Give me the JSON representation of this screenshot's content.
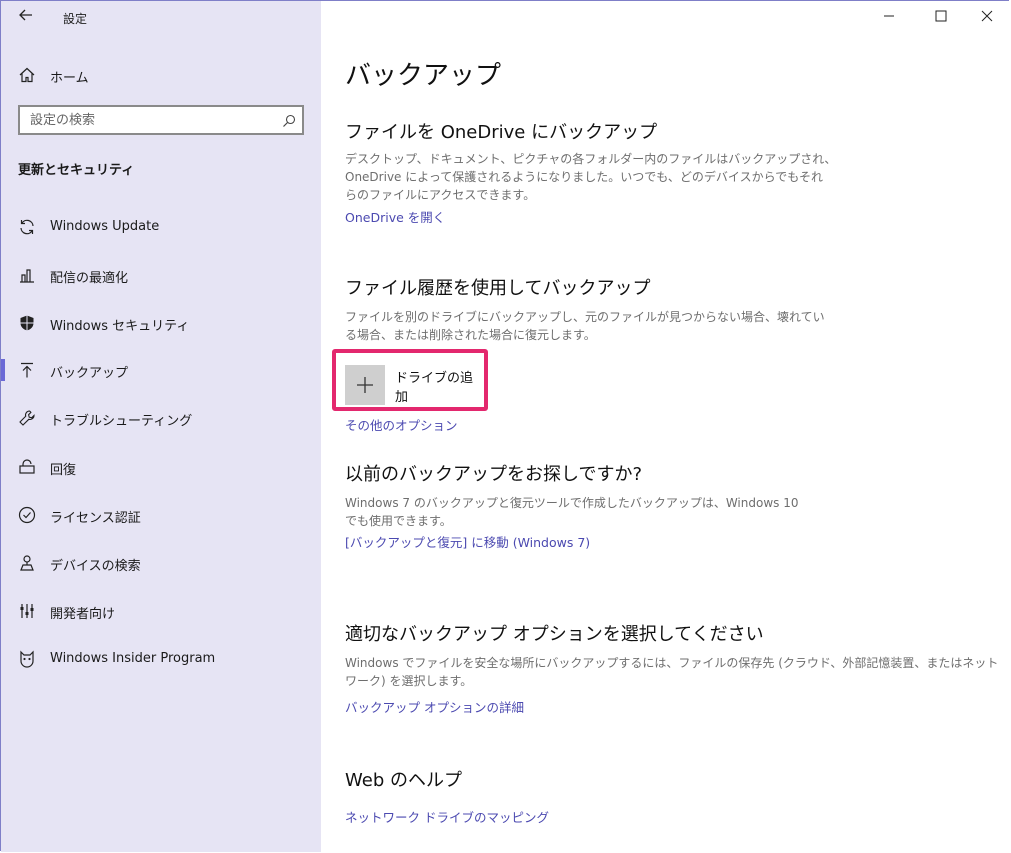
{
  "app": {
    "title": "設定"
  },
  "sidebar": {
    "home_label": "ホーム",
    "search_placeholder": "設定の検索",
    "section_title": "更新とセキュリティ",
    "items": [
      {
        "label": "Windows Update",
        "icon": "sync-icon"
      },
      {
        "label": "配信の最適化",
        "icon": "delivery-optimization-icon"
      },
      {
        "label": "Windows セキュリティ",
        "icon": "shield-icon"
      },
      {
        "label": "バックアップ",
        "icon": "backup-arrow-icon"
      },
      {
        "label": "トラブルシューティング",
        "icon": "wrench-icon"
      },
      {
        "label": "回復",
        "icon": "recovery-icon"
      },
      {
        "label": "ライセンス認証",
        "icon": "check-circle-icon"
      },
      {
        "label": "デバイスの検索",
        "icon": "find-device-icon"
      },
      {
        "label": "開発者向け",
        "icon": "developer-icon"
      },
      {
        "label": "Windows Insider Program",
        "icon": "insider-cat-icon"
      }
    ],
    "active_index": 3
  },
  "main": {
    "title": "バックアップ",
    "onedrive": {
      "heading": "ファイルを OneDrive にバックアップ",
      "line1": "デスクトップ、ドキュメント、ピクチャの各フォルダー内のファイルはバックアップされ、",
      "line2": "OneDrive によって保護されるようになりました。いつでも、どのデバイスからでもそれ",
      "line3": "らのファイルにアクセスできます。",
      "link": "OneDrive を開く"
    },
    "file_history": {
      "heading": "ファイル履歴を使用してバックアップ",
      "line1": "ファイルを別のドライブにバックアップし、元のファイルが見つからない場合、壊れてい",
      "line2": "る場合、または削除された場合に復元します。",
      "add_drive": "ドライブの追加",
      "more_options": "その他のオプション"
    },
    "older_backup": {
      "heading": "以前のバックアップをお探しですか?",
      "line1": "Windows 7 のバックアップと復元ツールで作成したバックアップは、Windows 10",
      "line2": "でも使用できます。",
      "link": "[バックアップと復元] に移動 (Windows 7)"
    },
    "choose_option": {
      "heading": "適切なバックアップ オプションを選択してください",
      "line1": "Windows でファイルを安全な場所にバックアップするには、ファイルの保存先 (クラウド、外部記憶装置、またはネット",
      "line2": "ワーク) を選択します。",
      "link": "バックアップ オプションの詳細"
    },
    "web_help": {
      "heading": "Web のヘルプ",
      "link": "ネットワーク ドライブのマッピング"
    }
  },
  "colors": {
    "sidebar_bg": "#e6e4f4",
    "accent": "#6b69d6",
    "link": "#4b49b0",
    "highlight": "#e3286e"
  }
}
